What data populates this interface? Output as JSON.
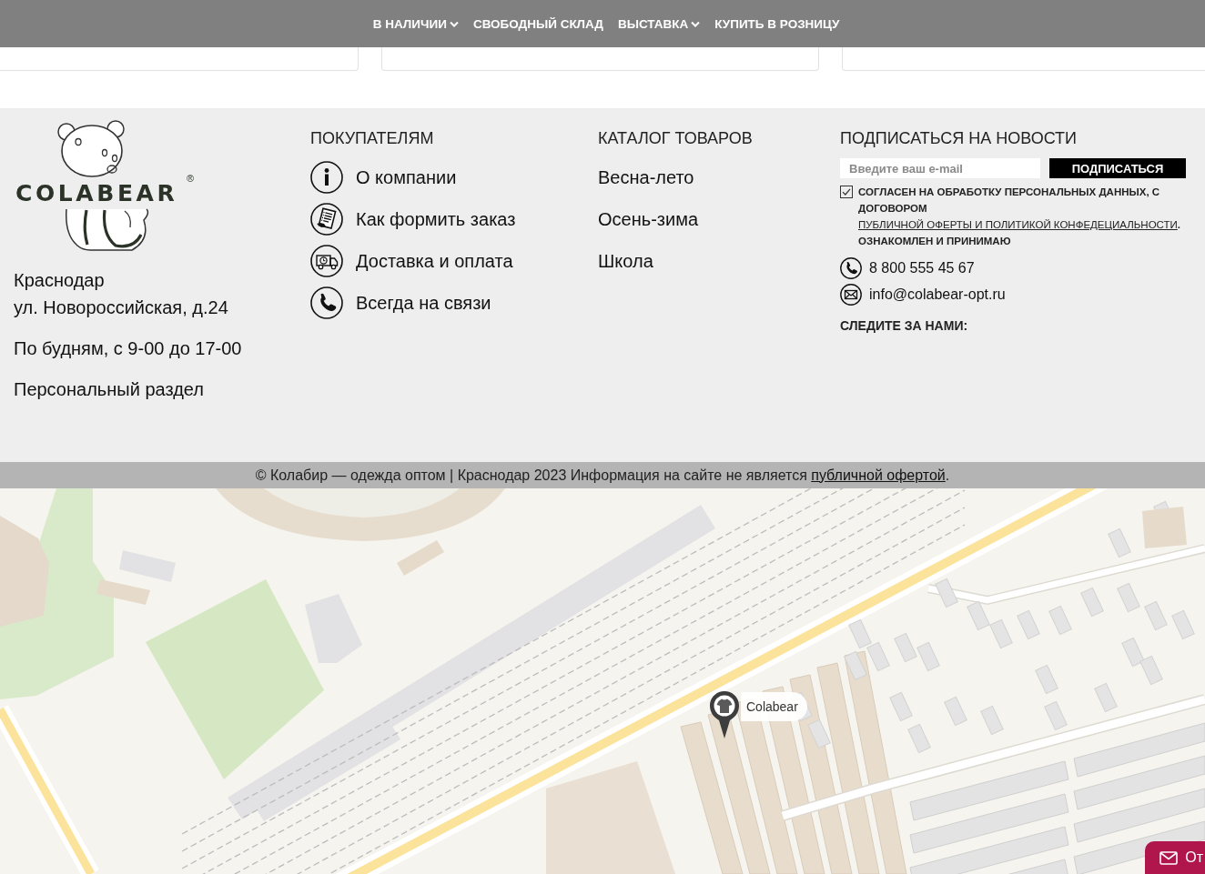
{
  "nav": {
    "items": [
      {
        "label": "В НАЛИЧИИ",
        "dropdown": true
      },
      {
        "label": "СВОБОДНЫЙ СКЛАД",
        "dropdown": false
      },
      {
        "label": "ВЫСТАВКА",
        "dropdown": true
      },
      {
        "label": "КУПИТЬ В РОЗНИЦУ",
        "dropdown": false
      }
    ]
  },
  "footer": {
    "logo": {
      "text": "COLABEAR",
      "mark": "®"
    },
    "address": [
      "Краснодар",
      "ул. Новороссийская, д.24"
    ],
    "hours": "По будням, с 9-00 до 17-00",
    "personal_link": "Персональный раздел",
    "buyers": {
      "title": "ПОКУПАТЕЛЯМ",
      "items": [
        "О компании",
        "Как формить заказ",
        "Доставка и оплата",
        "Всегда на связи"
      ]
    },
    "catalog": {
      "title": "КАТАЛОГ ТОВАРОВ",
      "items": [
        "Весна-лето",
        "Осень-зима",
        "Школа"
      ]
    },
    "subscribe": {
      "title": "ПОДПИСАТЬСЯ НА НОВОСТИ",
      "placeholder": "Введите ваш e-mail",
      "button": "ПОДПИСАТЬСЯ",
      "consent": {
        "checked": true,
        "text_before": "СОГЛАСЕН НА ОБРАБОТКУ ПЕРСОНАЛЬНЫХ ДАННЫХ, С ДОГОВОРОМ ",
        "link": "ПУБЛИЧНОЙ ОФЕРТЫ И ПОЛИТИКОЙ КОНФЕДЕЦИАЛЬНОСТИ",
        "text_after": ". ОЗНАКОМЛЕН И ПРИНИМАЮ"
      },
      "phone": "8 800 555 45 67",
      "email": "info@colabear-opt.ru",
      "follow_title": "СЛЕДИТЕ ЗА НАМИ:"
    }
  },
  "copyright": {
    "text_before": "© Колабир — одежда оптом | Краснодар 2023 Информация на сайте не является ",
    "link": "публичной офертой",
    "text_after": "."
  },
  "map": {
    "marker_label": "Colabear"
  },
  "message_button": {
    "label": "От"
  }
}
